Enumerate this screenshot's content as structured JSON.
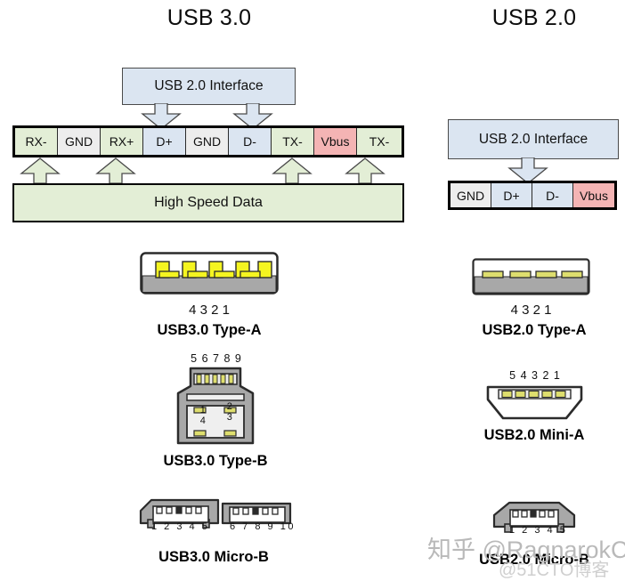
{
  "columns": {
    "left": {
      "title": "USB 3.0"
    },
    "right": {
      "title": "USB 2.0"
    }
  },
  "usb3_block": {
    "interface_label": "USB 2.0 Interface",
    "high_speed_label": "High Speed Data",
    "pins": [
      {
        "label": "RX-",
        "color": "#e3eed6"
      },
      {
        "label": "GND",
        "color": "#ededed"
      },
      {
        "label": "RX+",
        "color": "#e3eed6"
      },
      {
        "label": "D+",
        "color": "#dbe5f1"
      },
      {
        "label": "GND",
        "color": "#ededed"
      },
      {
        "label": "D-",
        "color": "#dbe5f1"
      },
      {
        "label": "TX-",
        "color": "#e3eed6"
      },
      {
        "label": "Vbus",
        "color": "#f4b4b4"
      },
      {
        "label": "TX-",
        "color": "#e3eed6"
      }
    ]
  },
  "usb2_block": {
    "interface_label": "USB 2.0 Interface",
    "pins": [
      {
        "label": "GND",
        "color": "#ededed"
      },
      {
        "label": "D+",
        "color": "#dbe5f1"
      },
      {
        "label": "D-",
        "color": "#dbe5f1"
      },
      {
        "label": "Vbus",
        "color": "#f4b4b4"
      }
    ]
  },
  "connectors": {
    "usb3_type_a": {
      "caption": "USB3.0 Type-A",
      "pin_numbers": "4   3   2   1"
    },
    "usb2_type_a": {
      "caption": "USB2.0 Type-A",
      "pin_numbers": "4   3   2   1"
    },
    "usb3_type_b": {
      "caption": "USB3.0 Type-B",
      "pin_numbers_top": "5 6 7 8 9",
      "pin_tl": "1",
      "pin_tr": "2",
      "pin_bl": "4",
      "pin_br": "3"
    },
    "usb2_mini_a": {
      "caption": "USB2.0 Mini-A",
      "pin_numbers": "5 4 3 2 1"
    },
    "usb3_micro_b": {
      "caption": "USB3.0 Micro-B",
      "pin_numbers_left": "1 2 3 4 5",
      "pin_numbers_right": "6 7 8 9 10"
    },
    "usb2_micro_b": {
      "caption": "USB2.0 Micro-B",
      "pin_numbers": "1 2 3 4 5"
    }
  },
  "watermark": {
    "line1": "知乎 @RagnarokChan",
    "line2": "@51CTO博客"
  },
  "colors": {
    "green": "#e3eed6",
    "blue": "#dbe5f1",
    "red": "#f4b4b4",
    "grey": "#ededed",
    "metal": "#a8a8a8",
    "pin_yellow": "#f5f520",
    "pin_olive": "#dede6e",
    "outline": "#2b2b2b"
  }
}
